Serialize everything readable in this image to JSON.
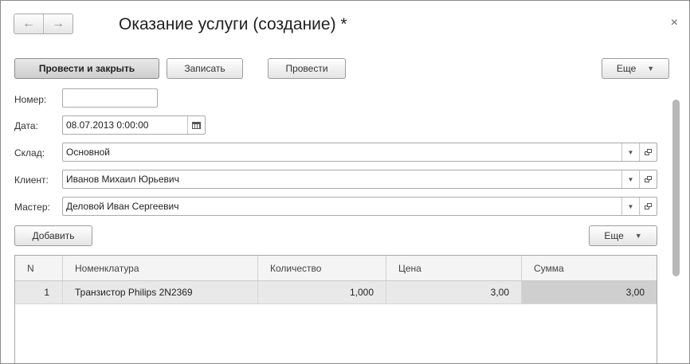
{
  "window": {
    "title": "Оказание услуги (создание) *",
    "nav": {
      "back_icon": "←",
      "forward_icon": "→"
    },
    "close_icon": "×"
  },
  "toolbar": {
    "post_close_label": "Провести и закрыть",
    "save_label": "Записать",
    "post_label": "Провести",
    "more_label": "Еще",
    "more_caret": "▼"
  },
  "form": {
    "number": {
      "label": "Номер:",
      "value": ""
    },
    "date": {
      "label": "Дата:",
      "value": "08.07.2013  0:00:00"
    },
    "warehouse": {
      "label": "Склад:",
      "value": "Основной"
    },
    "client": {
      "label": "Клиент:",
      "value": "Иванов Михаил Юрьевич"
    },
    "master": {
      "label": "Мастер:",
      "value": "Деловой Иван Сергеевич"
    }
  },
  "table_toolbar": {
    "add_label": "Добавить",
    "more_label": "Еще",
    "more_caret": "▼"
  },
  "table": {
    "columns": [
      "N",
      "Номенклатура",
      "Количество",
      "Цена",
      "Сумма"
    ],
    "rows": [
      [
        "1",
        "Транзистор Philips 2N2369",
        "1,000",
        "3,00",
        "3,00"
      ]
    ]
  },
  "field_caret": "▼"
}
